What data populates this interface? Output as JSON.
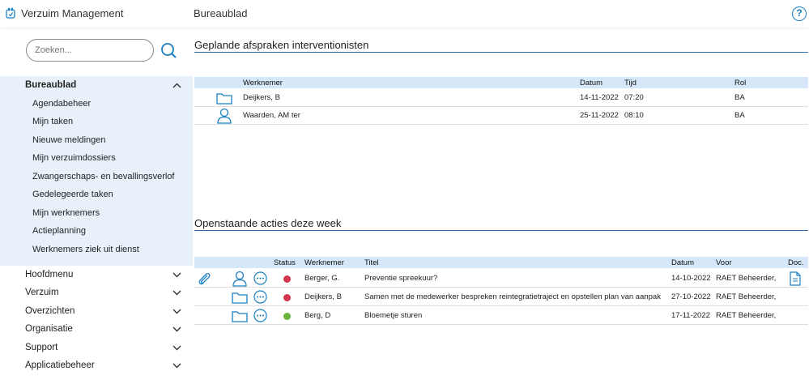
{
  "header": {
    "app_title": "Verzuim Management",
    "page_title": "Bureaublad",
    "help_label": "?"
  },
  "sidebar": {
    "search_placeholder": "Zoeken...",
    "open_section": {
      "label": "Bureaublad",
      "items": [
        "Agendabeheer",
        "Mijn taken",
        "Nieuwe meldingen",
        "Mijn verzuimdossiers",
        "Zwangerschaps- en bevallingsverlof",
        "Gedelegeerde taken",
        "Mijn werknemers",
        "Actieplanning",
        "Werknemers ziek uit dienst"
      ]
    },
    "sections": [
      "Hoofdmenu",
      "Verzuim",
      "Overzichten",
      "Organisatie",
      "Support",
      "Applicatiebeheer"
    ]
  },
  "appointments": {
    "title": "Geplande afspraken interventionisten",
    "columns": {
      "werknemer": "Werknemer",
      "datum": "Datum",
      "tijd": "Tijd",
      "rol": "Rol"
    },
    "rows": [
      {
        "icon": "folder-icon",
        "werknemer": "Deijkers, B",
        "datum": "14-11-2022",
        "tijd": "07:20",
        "rol": "BA"
      },
      {
        "icon": "user-icon",
        "werknemer": "Waarden, AM ter",
        "datum": "25-11-2022",
        "tijd": "08:10",
        "rol": "BA"
      }
    ]
  },
  "actions": {
    "title": "Openstaande acties deze week",
    "columns": {
      "status": "Status",
      "werknemer": "Werknemer",
      "titel": "Titel",
      "datum": "Datum",
      "voor": "Voor",
      "doc": "Doc."
    },
    "rows": [
      {
        "status_color": "#d1344b",
        "werknemer": "Berger, G.",
        "titel": "Preventie spreekuur?",
        "datum": "14-10-2022",
        "voor": "RAET Beheerder,"
      },
      {
        "status_color": "#d1344b",
        "werknemer": "Deijkers, B",
        "titel": "Samen met de medewerker bespreken reintegratietraject en opstellen plan van aanpak",
        "datum": "27-10-2022",
        "voor": "RAET Beheerder,"
      },
      {
        "status_color": "#6cb33f",
        "werknemer": "Berg, D",
        "titel": "Bloemetje sturen",
        "datum": "17-11-2022",
        "voor": "RAET Beheerder,"
      }
    ]
  },
  "colors": {
    "accent": "#1a7fc1",
    "nav_bg": "#e8f1fa",
    "table_header": "#d5e7f8",
    "section_line": "#2b6ca8"
  }
}
